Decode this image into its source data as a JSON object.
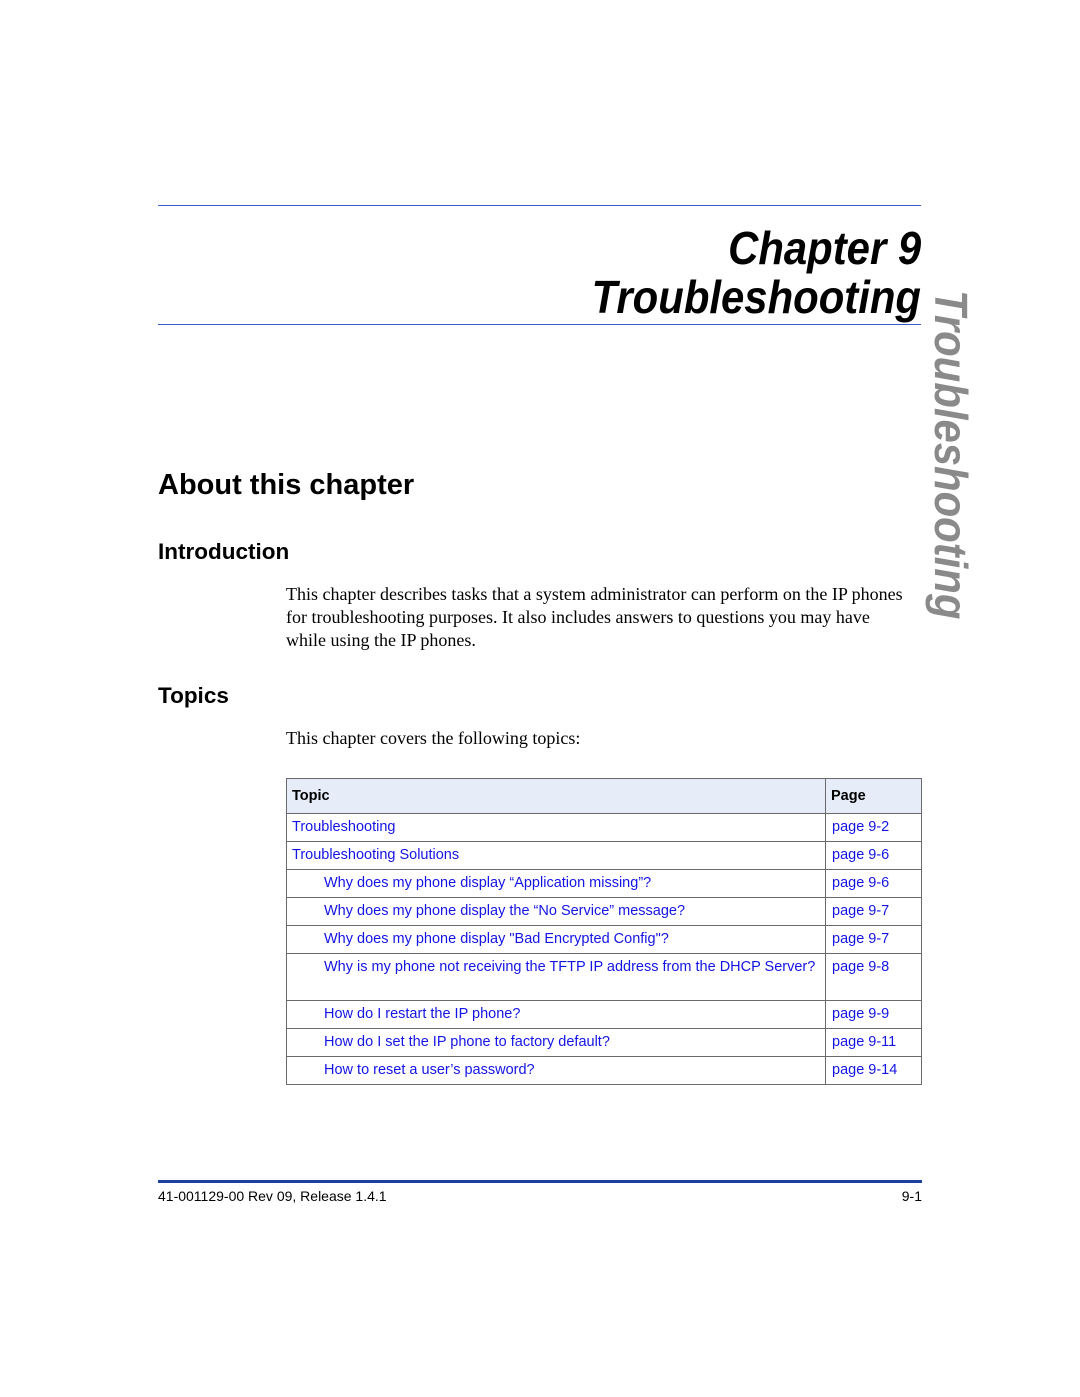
{
  "header": {
    "chapter_label": "Chapter 9",
    "chapter_title": "Troubleshooting"
  },
  "side_tab": {
    "label": "Troubleshooting"
  },
  "section": {
    "title": "About this chapter"
  },
  "introduction": {
    "heading": "Introduction",
    "body": "This chapter describes tasks that a system administrator can perform on the IP phones for troubleshooting purposes. It also includes answers to questions you may have while using the IP phones."
  },
  "topics": {
    "heading": "Topics",
    "intro": "This chapter covers the following topics:",
    "table": {
      "columns": [
        "Topic",
        "Page"
      ],
      "rows": [
        {
          "topic": "Troubleshooting",
          "page": "page 9-2",
          "level": 1
        },
        {
          "topic": "Troubleshooting Solutions",
          "page": "page 9-6",
          "level": 1
        },
        {
          "topic": "Why does my phone display “Application missing”?",
          "page": "page 9-6",
          "level": 2
        },
        {
          "topic": "Why does my phone display the “No Service” message?",
          "page": "page 9-7",
          "level": 2
        },
        {
          "topic": "Why does my phone display \"Bad Encrypted Config\"?",
          "page": "page 9-7",
          "level": 2
        },
        {
          "topic": "Why is my phone not receiving the TFTP IP address from the DHCP Server?",
          "page": "page 9-8",
          "level": 2
        },
        {
          "topic": "How do I restart the IP phone?",
          "page": "page 9-9",
          "level": 2
        },
        {
          "topic": "How do I set the IP phone to factory default?",
          "page": "page 9-11",
          "level": 2
        },
        {
          "topic": "How to reset a user’s password?",
          "page": "page 9-14",
          "level": 2
        }
      ]
    }
  },
  "footer": {
    "doc_id": "41-001129-00 Rev 09, Release 1.4.1",
    "page_number": "9-1"
  },
  "colors": {
    "rule": "#3c5ac8",
    "footer_rule": "#1f3f9f",
    "link": "#1414e6",
    "table_header_bg": "#e6edf9",
    "side_tab_text": "#8a8a8a"
  }
}
